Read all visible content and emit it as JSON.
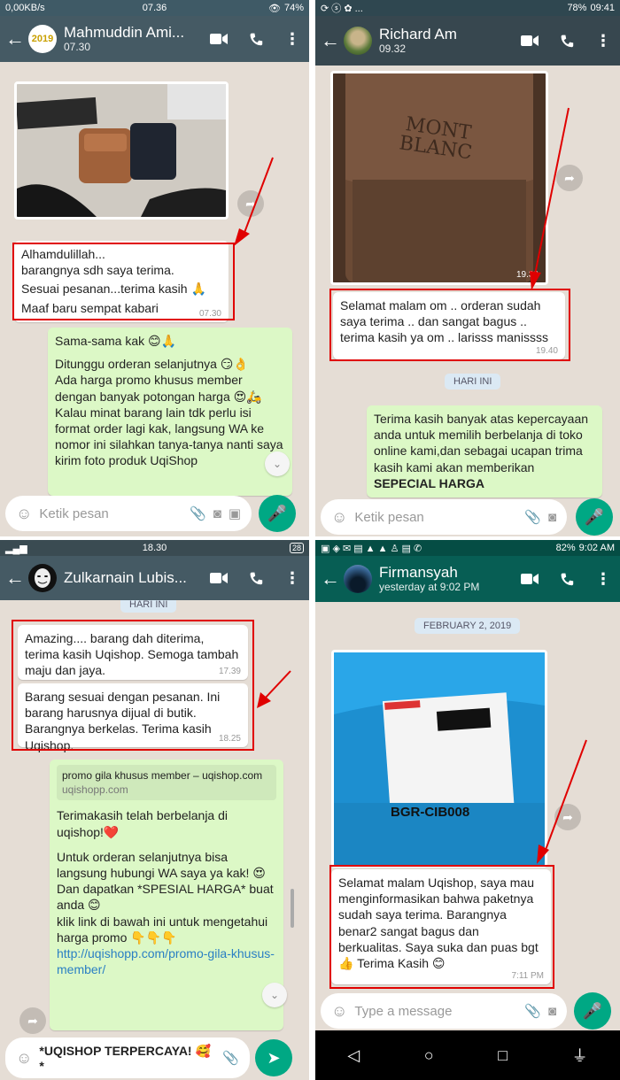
{
  "panel1": {
    "status": {
      "left": "0,00KB/s",
      "time": "07.36",
      "battery": "74%"
    },
    "contact": {
      "name": "Mahmuddin Ami...",
      "sub": "07.30",
      "avatar_text": "2019"
    },
    "incoming": {
      "lines": [
        "Alhamdulillah...",
        "barangnya sdh saya terima.",
        "Sesuai pesanan...terima kasih 🙏",
        "Maaf baru sempat kabari"
      ],
      "time": "07.30"
    },
    "outgoing": {
      "lines": [
        "Sama-sama kak 😊🙏",
        "Ditunggu orderan selanjutnya 😏👌",
        "Ada harga promo khusus member dengan banyak potongan harga 😍🛵",
        "Kalau minat barang lain tdk perlu isi format order lagi kak, langsung WA ke nomor ini silahkan tanya-tanya nanti saya kirim foto produk UqiShop"
      ]
    },
    "input_placeholder": "Ketik pesan"
  },
  "panel2": {
    "status": {
      "battery": "78%",
      "time": "09:41"
    },
    "contact": {
      "name": "Richard Am",
      "sub": "09.32"
    },
    "photo": {
      "brand_line1": "MONT",
      "brand_line2": "BLANC",
      "time": "19.39"
    },
    "incoming": {
      "text": "Selamat malam om .. orderan sudah saya terima .. dan sangat bagus .. terima kasih ya om .. larisss manissss",
      "time": "19.40"
    },
    "day_chip": "HARI INI",
    "outgoing": {
      "text": "Terima kasih banyak atas kepercayaan anda untuk memilih berbelanja di toko online kami,dan sebagai ucapan trima kasih kami akan memberikan",
      "bold": "SEPECIAL HARGA"
    },
    "input_placeholder": "Ketik pesan"
  },
  "panel3": {
    "status": {
      "time": "18.30",
      "battery": "28"
    },
    "contact": {
      "name": "Zulkarnain Lubis..."
    },
    "day_chip": "HARI INI",
    "incoming1": {
      "text": "Amazing.... barang dah diterima, terima kasih Uqishop. Semoga tambah maju dan jaya.",
      "time": "17.39"
    },
    "incoming2": {
      "text": "Barang sesuai dengan pesanan. Ini barang harusnya dijual di butik. Barangnya berkelas. Terima kasih Uqishop.",
      "time": "18.25"
    },
    "outgoing": {
      "preview_title": "promo gila khusus member – uqishop.com",
      "preview_domain": "uqishopp.com",
      "lines": [
        "Terimakasih telah berbelanja di uqishop!❤️",
        "Untuk orderan selanjutnya bisa langsung hubungi WA saya ya kak! 😍",
        "Dan dapatkan *SPESIAL HARGA* buat anda 😊",
        "klik link di bawah ini untuk mengetahui harga promo 👇👇👇"
      ],
      "link": "http://uqishopp.com/promo-gila-khusus-member/"
    },
    "input_text": "*UQISHOP TERPERCAYA! 🥰*"
  },
  "panel4": {
    "status": {
      "battery": "82%",
      "time": "9:02 AM"
    },
    "contact": {
      "name": "Firmansyah",
      "sub": "yesterday at 9:02 PM"
    },
    "day_chip": "FEBRUARY 2, 2019",
    "photo": {
      "label": "BGR-CIB008"
    },
    "incoming": {
      "text": "Selamat malam Uqishop, saya mau menginformasikan bahwa paketnya sudah saya terima. Barangnya benar2 sangat bagus dan berkualitas. Saya suka dan puas bgt 👍 Terima Kasih 😊",
      "time": "7:11 PM"
    },
    "input_placeholder": "Type a message"
  },
  "colors": {
    "teal_dark": "#075e54",
    "teal_gray": "#455a64",
    "green_out": "#dcf8c6",
    "red_box": "#e00000",
    "mic_green": "#00a884"
  }
}
